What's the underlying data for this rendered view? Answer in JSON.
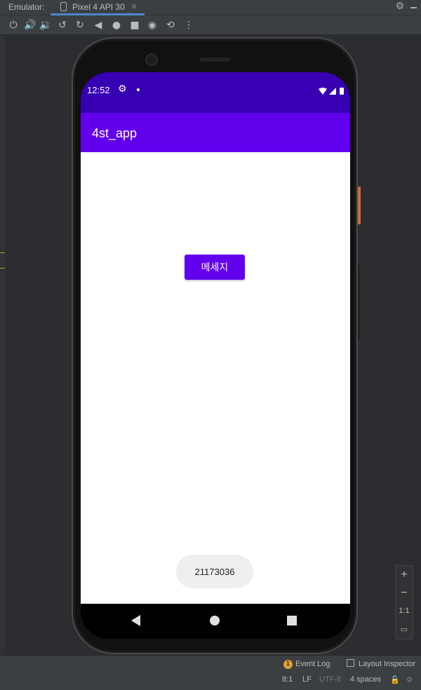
{
  "ide": {
    "emulator_label": "Emulator:",
    "tab_label": "Pixel 4 API 30",
    "tab_close": "×",
    "bottom": {
      "event_log_count": "1",
      "event_log": "Event Log",
      "layout_inspector": "Layout Inspector"
    },
    "statusline": {
      "position": "8:1",
      "line_sep": "LF",
      "encoding": "UTF-8",
      "indent": "4 spaces"
    },
    "zoom": {
      "plus": "+",
      "minus": "−",
      "one_to_one": "1:1"
    }
  },
  "device": {
    "status_bar": {
      "time": "12:52"
    },
    "app_bar": {
      "title": "4st_app"
    },
    "main": {
      "button_label": "메세지"
    },
    "toast": {
      "text": "21173036"
    }
  },
  "colors": {
    "status_bar": "#3700b3",
    "app_bar": "#6200ee",
    "button": "#6200ee",
    "toast_bg": "#efefef",
    "ide_bg": "#2b2d30"
  }
}
